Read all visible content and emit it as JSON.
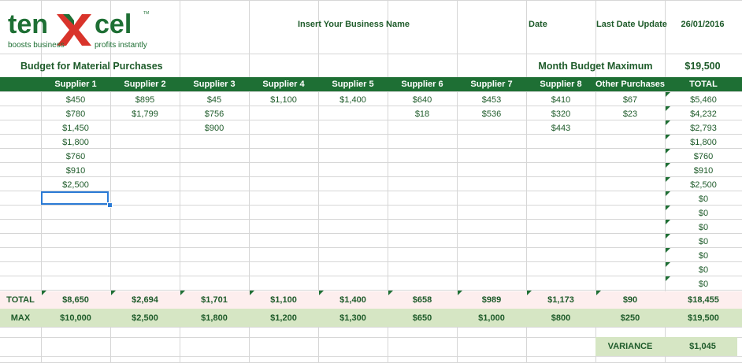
{
  "logo": {
    "brand_part1": "ten",
    "brand_part2": "cel",
    "tm": "TM",
    "tagline_left": "boosts business",
    "tagline_right": "profits instantly"
  },
  "header": {
    "business_name": "Insert Your Business Name",
    "date_label": "Date",
    "last_update_label": "Last Date Update",
    "last_update_value": "26/01/2016"
  },
  "title_row": {
    "title": "Budget for Material Purchases",
    "max_label": "Month Budget Maximum",
    "max_value": "$19,500"
  },
  "columns": [
    "Supplier 1",
    "Supplier 2",
    "Supplier 3",
    "Supplier 4",
    "Supplier 5",
    "Supplier 6",
    "Supplier 7",
    "Supplier 8",
    "Other Purchases",
    "TOTAL"
  ],
  "rows": [
    [
      "$450",
      "$895",
      "$45",
      "$1,100",
      "$1,400",
      "$640",
      "$453",
      "$410",
      "$67",
      "$5,460"
    ],
    [
      "$780",
      "$1,799",
      "$756",
      "",
      "",
      "$18",
      "$536",
      "$320",
      "$23",
      "$4,232"
    ],
    [
      "$1,450",
      "",
      "$900",
      "",
      "",
      "",
      "",
      "$443",
      "",
      "$2,793"
    ],
    [
      "$1,800",
      "",
      "",
      "",
      "",
      "",
      "",
      "",
      "",
      "$1,800"
    ],
    [
      "$760",
      "",
      "",
      "",
      "",
      "",
      "",
      "",
      "",
      "$760"
    ],
    [
      "$910",
      "",
      "",
      "",
      "",
      "",
      "",
      "",
      "",
      "$910"
    ],
    [
      "$2,500",
      "",
      "",
      "",
      "",
      "",
      "",
      "",
      "",
      "$2,500"
    ],
    [
      "",
      "",
      "",
      "",
      "",
      "",
      "",
      "",
      "",
      "$0"
    ],
    [
      "",
      "",
      "",
      "",
      "",
      "",
      "",
      "",
      "",
      "$0"
    ],
    [
      "",
      "",
      "",
      "",
      "",
      "",
      "",
      "",
      "",
      "$0"
    ],
    [
      "",
      "",
      "",
      "",
      "",
      "",
      "",
      "",
      "",
      "$0"
    ],
    [
      "",
      "",
      "",
      "",
      "",
      "",
      "",
      "",
      "",
      "$0"
    ],
    [
      "",
      "",
      "",
      "",
      "",
      "",
      "",
      "",
      "",
      "$0"
    ],
    [
      "",
      "",
      "",
      "",
      "",
      "",
      "",
      "",
      "",
      "$0"
    ]
  ],
  "totals": {
    "label": "TOTAL",
    "values": [
      "$8,650",
      "$2,694",
      "$1,701",
      "$1,100",
      "$1,400",
      "$658",
      "$989",
      "$1,173",
      "$90",
      "$18,455"
    ]
  },
  "max": {
    "label": "MAX",
    "values": [
      "$10,000",
      "$2,500",
      "$1,800",
      "$1,200",
      "$1,300",
      "$650",
      "$1,000",
      "$800",
      "$250",
      "$19,500"
    ]
  },
  "variance": {
    "label": "VARIANCE",
    "value": "$1,045"
  },
  "colors": {
    "header_green": "#1e6f34",
    "text_green": "#1e5b2a",
    "total_pink": "#fdeeee",
    "max_green": "#d6e6c4",
    "logo_red": "#d9342b"
  },
  "icons": {
    "logo": "tenxcel-logo-icon",
    "comment_marker": "comment-indicator-icon"
  }
}
